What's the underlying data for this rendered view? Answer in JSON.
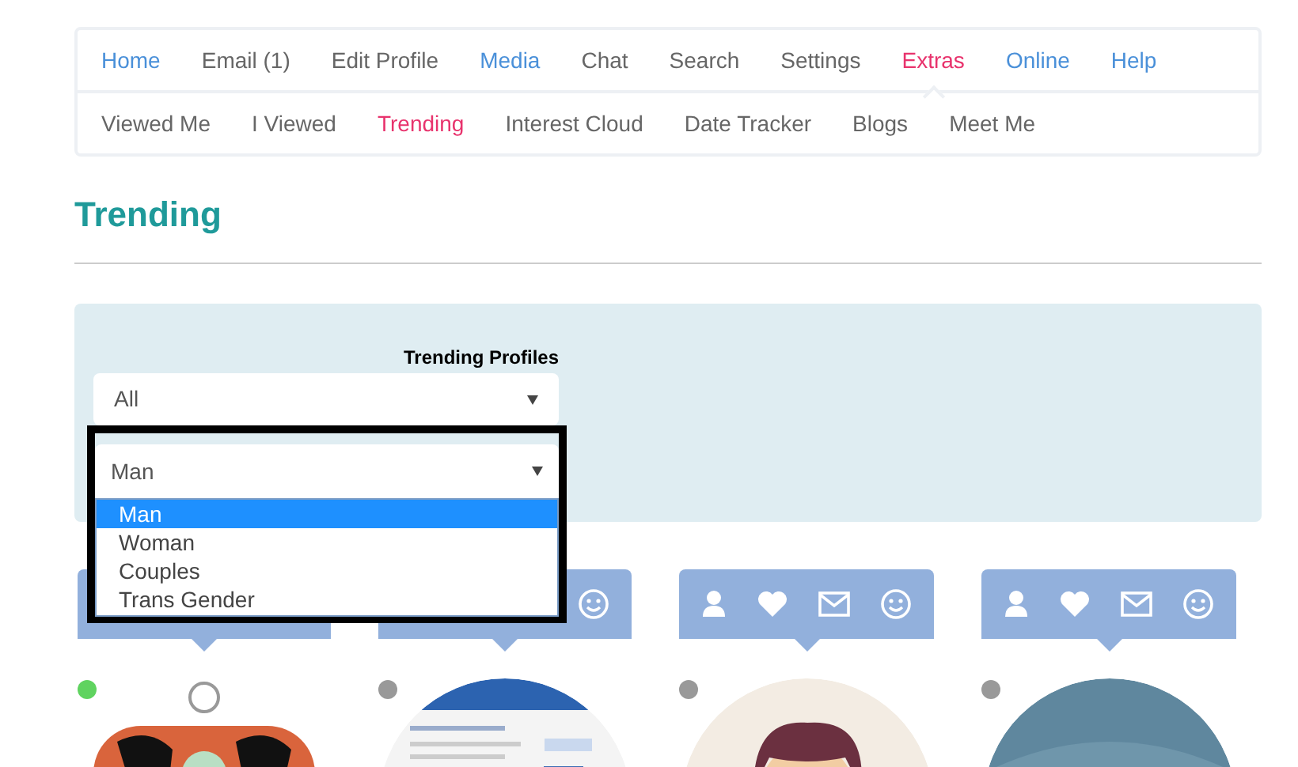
{
  "nav": {
    "main": [
      {
        "label": "Home",
        "color": "#4a90d9",
        "selected": false
      },
      {
        "label": "Email (1)",
        "color": "#666666",
        "selected": false
      },
      {
        "label": "Edit Profile",
        "color": "#666666",
        "selected": false
      },
      {
        "label": "Media",
        "color": "#4a90d9",
        "selected": false
      },
      {
        "label": "Chat",
        "color": "#666666",
        "selected": false
      },
      {
        "label": "Search",
        "color": "#666666",
        "selected": false
      },
      {
        "label": "Settings",
        "color": "#666666",
        "selected": false
      },
      {
        "label": "Extras",
        "selected": true
      },
      {
        "label": "Online",
        "color": "#4a90d9",
        "selected": false
      },
      {
        "label": "Help",
        "color": "#4a90d9",
        "selected": false
      }
    ],
    "sub": [
      {
        "label": "Viewed Me",
        "selected": false
      },
      {
        "label": "I Viewed",
        "selected": false
      },
      {
        "label": "Trending",
        "selected": true
      },
      {
        "label": "Interest Cloud",
        "selected": false
      },
      {
        "label": "Date Tracker",
        "selected": false
      },
      {
        "label": "Blogs",
        "selected": false
      },
      {
        "label": "Meet Me",
        "selected": false
      }
    ]
  },
  "title": "Trending",
  "filter": {
    "label": "Trending Profiles",
    "select_1": {
      "value": "All"
    },
    "select_2": {
      "value": "Man",
      "expanded": true,
      "options": [
        {
          "label": "Man",
          "selected": true
        },
        {
          "label": "Woman",
          "selected": false
        },
        {
          "label": "Couples",
          "selected": false
        },
        {
          "label": "Trans Gender",
          "selected": false
        }
      ]
    }
  },
  "cards": [
    {
      "online": true,
      "kind": "pattern"
    },
    {
      "online": false,
      "kind": "document",
      "action_icons": [
        {
          "kind": "smile"
        }
      ]
    },
    {
      "online": false,
      "kind": "cartoon",
      "action_icons": [
        {
          "kind": "user"
        },
        {
          "kind": "heart"
        },
        {
          "kind": "mail"
        },
        {
          "kind": "smile"
        }
      ]
    },
    {
      "online": false,
      "kind": "plain",
      "action_icons": [
        {
          "kind": "user"
        },
        {
          "kind": "heart"
        },
        {
          "kind": "mail"
        },
        {
          "kind": "smile"
        }
      ]
    }
  ]
}
